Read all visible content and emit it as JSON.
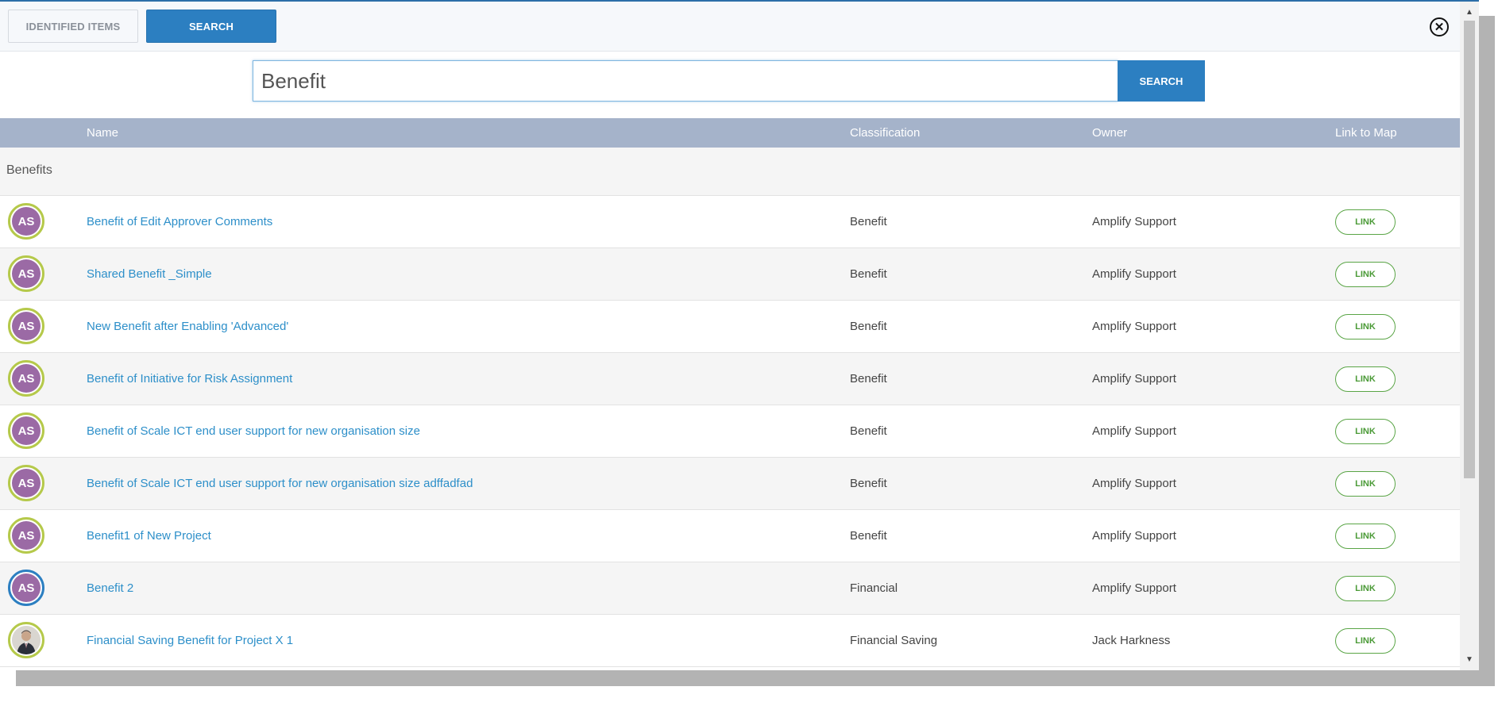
{
  "tabs": {
    "identified_label": "IDENTIFIED ITEMS",
    "search_label": "SEARCH"
  },
  "close_icon": "⊗",
  "search": {
    "value": "Benefit",
    "button_label": "SEARCH"
  },
  "table": {
    "headers": {
      "name": "Name",
      "classification": "Classification",
      "owner": "Owner",
      "link": "Link to Map"
    },
    "group_label": "Benefits",
    "rows": [
      {
        "avatar": "AS",
        "avatar_ring": "green",
        "name": "Benefit of Edit Approver Comments",
        "classification": "Benefit",
        "owner": "Amplify Support",
        "link_label": "LINK"
      },
      {
        "avatar": "AS",
        "avatar_ring": "green",
        "name": "Shared Benefit _Simple",
        "classification": "Benefit",
        "owner": "Amplify Support",
        "link_label": "LINK"
      },
      {
        "avatar": "AS",
        "avatar_ring": "green",
        "name": "New Benefit after Enabling 'Advanced'",
        "classification": "Benefit",
        "owner": "Amplify Support",
        "link_label": "LINK"
      },
      {
        "avatar": "AS",
        "avatar_ring": "green",
        "name": "Benefit of Initiative for Risk Assignment",
        "classification": "Benefit",
        "owner": "Amplify Support",
        "link_label": "LINK"
      },
      {
        "avatar": "AS",
        "avatar_ring": "green",
        "name": "Benefit of Scale ICT end user support for new organisation size",
        "classification": "Benefit",
        "owner": "Amplify Support",
        "link_label": "LINK"
      },
      {
        "avatar": "AS",
        "avatar_ring": "green",
        "name": "Benefit of Scale ICT end user support for new organisation size adffadfad",
        "classification": "Benefit",
        "owner": "Amplify Support",
        "link_label": "LINK"
      },
      {
        "avatar": "AS",
        "avatar_ring": "green",
        "name": "Benefit1 of New Project",
        "classification": "Benefit",
        "owner": "Amplify Support",
        "link_label": "LINK"
      },
      {
        "avatar": "AS",
        "avatar_ring": "blue",
        "name": "Benefit 2",
        "classification": "Financial",
        "owner": "Amplify Support",
        "link_label": "LINK"
      },
      {
        "avatar": "",
        "avatar_ring": "green",
        "avatar_photo": true,
        "name": "Financial Saving Benefit for Project X 1",
        "classification": "Financial Saving",
        "owner": "Jack Harkness",
        "link_label": "LINK"
      }
    ]
  },
  "colors": {
    "accent": "#2c7fc1",
    "header_bg": "#a5b3ca",
    "link_green": "#5aa546",
    "avatar_purple": "#9b6aa5",
    "ring_green": "#b5c94a"
  }
}
